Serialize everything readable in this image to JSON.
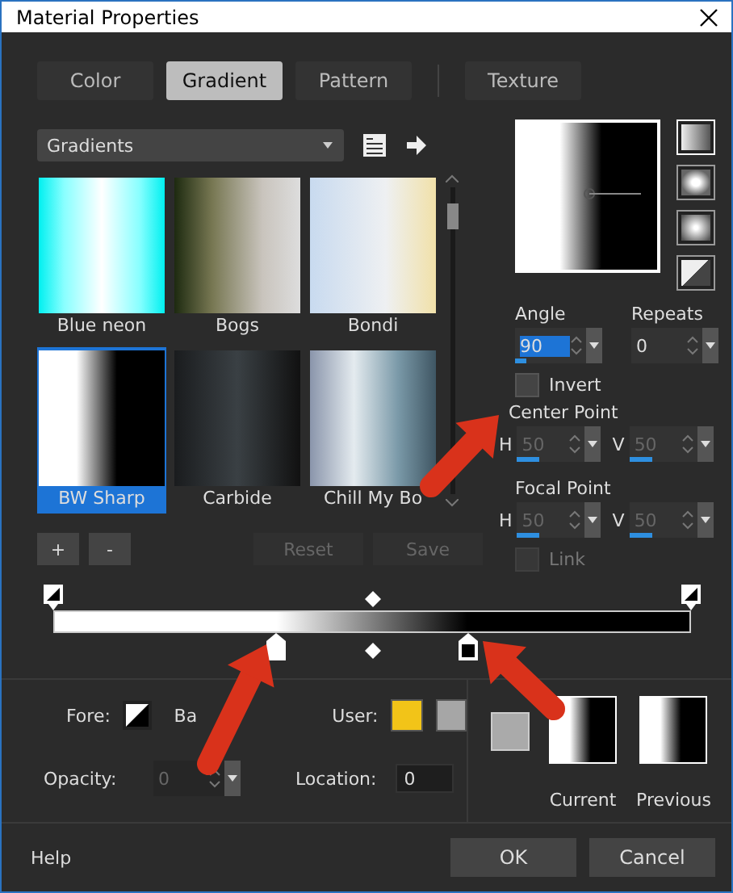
{
  "window": {
    "title": "Material Properties"
  },
  "tabs": [
    {
      "label": "Color",
      "selected": false
    },
    {
      "label": "Gradient",
      "selected": true
    },
    {
      "label": "Pattern",
      "selected": false
    },
    {
      "label": "Texture",
      "selected": false
    }
  ],
  "library": {
    "dropdown": "Gradients",
    "items": [
      {
        "label": "Blue neon",
        "selected": false
      },
      {
        "label": "Bogs",
        "selected": false
      },
      {
        "label": "Bondi",
        "selected": false
      },
      {
        "label": "BW Sharp",
        "selected": true
      },
      {
        "label": "Carbide",
        "selected": false
      },
      {
        "label": "Chill My Bo",
        "selected": false
      }
    ],
    "buttons": [
      {
        "label": "+",
        "disabled": false
      },
      {
        "label": "-",
        "disabled": false
      },
      {
        "label": "Reset",
        "disabled": true
      },
      {
        "label": "Save",
        "disabled": true
      }
    ]
  },
  "styles": [
    {
      "kind": "linear",
      "selected": true
    },
    {
      "kind": "rectangular",
      "selected": false
    },
    {
      "kind": "sunburst",
      "selected": false
    },
    {
      "kind": "radial",
      "selected": false
    }
  ],
  "angle": {
    "label": "Angle",
    "value": "90"
  },
  "repeats": {
    "label": "Repeats",
    "value": "0"
  },
  "invert": {
    "label": "Invert",
    "checked": false
  },
  "center_point": {
    "label": "Center Point",
    "h": {
      "label": "H",
      "value": "50",
      "disabled": true
    },
    "v": {
      "label": "V",
      "value": "50",
      "disabled": true
    }
  },
  "focal_point": {
    "label": "Focal Point",
    "h": {
      "label": "H",
      "value": "50",
      "disabled": true
    },
    "v": {
      "label": "V",
      "value": "50",
      "disabled": true
    }
  },
  "link": {
    "label": "Link",
    "checked": false,
    "disabled": true
  },
  "editor": {
    "color_stops": [
      {
        "color": "#ffffff"
      },
      {
        "color": "#000000"
      }
    ]
  },
  "fore": {
    "label": "Fore:"
  },
  "back": {
    "label": "Ba"
  },
  "user": {
    "label": "User:",
    "swatches": [
      {
        "color": "#f2c418"
      },
      {
        "color": "#a6a6a6"
      }
    ]
  },
  "opacity": {
    "label": "Opacity:",
    "value": "0",
    "disabled": true
  },
  "location": {
    "label": "Location:",
    "value": "0"
  },
  "current": {
    "label": "Current"
  },
  "previous": {
    "label": "Previous"
  },
  "footer": {
    "help": "Help",
    "buttons": [
      "OK",
      "Cancel"
    ]
  }
}
